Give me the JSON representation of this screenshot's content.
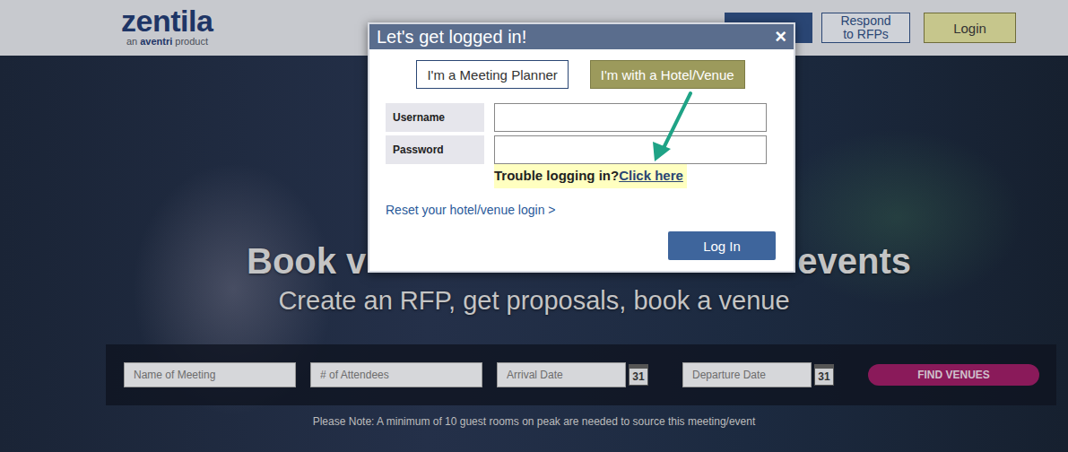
{
  "header": {
    "logo": "zentila",
    "tagline": {
      "prefix": "an",
      "brand": "aventri",
      "suffix": "product"
    },
    "respond_button": [
      "Respond",
      "to RFPs"
    ],
    "login_button": "Login"
  },
  "hero": {
    "title_parts": [
      "Book v",
      "events"
    ],
    "subtitle": "Create an RFP, get proposals, book a venue"
  },
  "search": {
    "fields": [
      {
        "placeholder": "Name of Meeting",
        "kind": "text"
      },
      {
        "placeholder": "# of Attendees",
        "kind": "text"
      },
      {
        "placeholder": "Arrival Date",
        "kind": "date",
        "icon": "31"
      },
      {
        "placeholder": "Departure Date",
        "kind": "date",
        "icon": "31"
      }
    ],
    "button": "FIND VENUES",
    "note": "Please Note: A minimum of 10 guest rooms on peak are needed to source this meeting/event"
  },
  "modal": {
    "title": "Let's get logged in!",
    "close": "×",
    "tabs": [
      {
        "label": "I'm a Meeting Planner",
        "selected": false
      },
      {
        "label": "I'm with a Hotel/Venue",
        "selected": true
      }
    ],
    "fields": [
      {
        "label": "Username",
        "value": ""
      },
      {
        "label": "Password",
        "value": ""
      }
    ],
    "help": {
      "text": "Trouble logging in?",
      "link": "Click here"
    },
    "reset_link": "Reset your hotel/venue login >",
    "submit": "Log In"
  }
}
